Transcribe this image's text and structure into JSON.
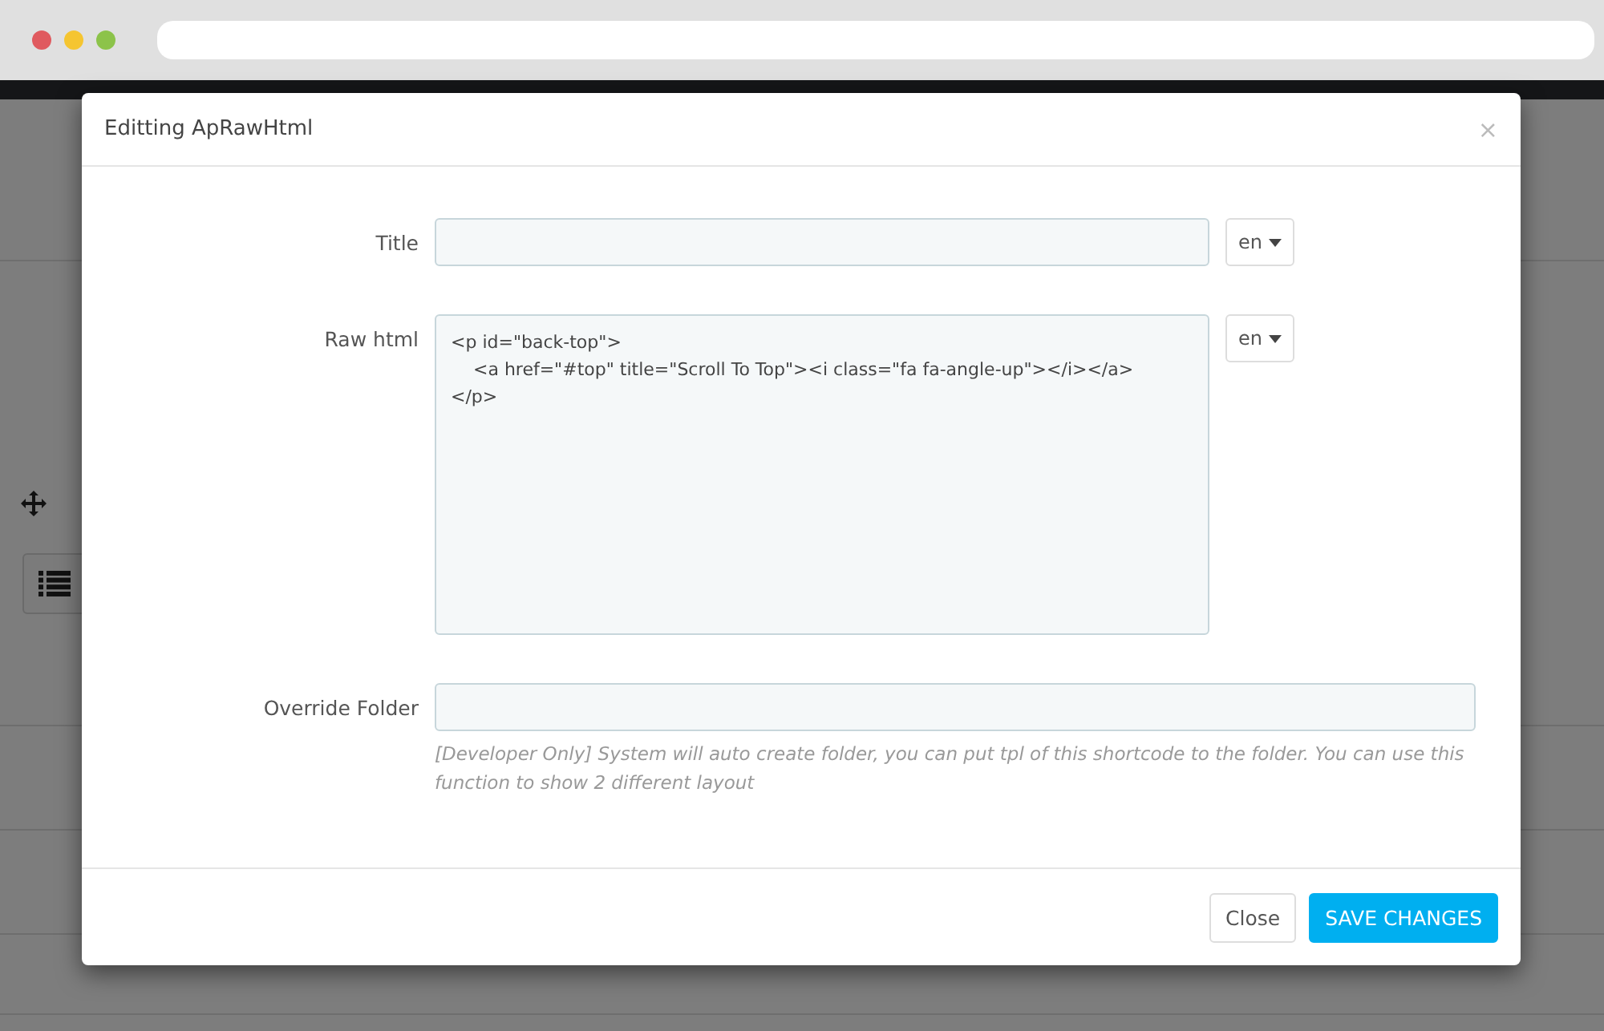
{
  "modal": {
    "title": "Editting ApRawHtml",
    "close_icon": "×"
  },
  "fields": [
    {
      "kind": "input",
      "label": "Title",
      "language": "en"
    },
    {
      "kind": "textarea",
      "label": "Raw html",
      "value": "<p id=\"back-top\">\n    <a href=\"#top\" title=\"Scroll To Top\"><i class=\"fa fa-angle-up\"></i></a>\n</p>",
      "language": "en"
    },
    {
      "kind": "input",
      "label": "Override Folder",
      "help": "[Developer Only] System will auto create folder, you can put tpl of this shortcode to the folder. You can use this function to show 2 different layout"
    }
  ],
  "buttons": [
    {
      "label": "Close",
      "kind": "default"
    },
    {
      "label": "SAVE CHANGES",
      "kind": "primary"
    }
  ]
}
